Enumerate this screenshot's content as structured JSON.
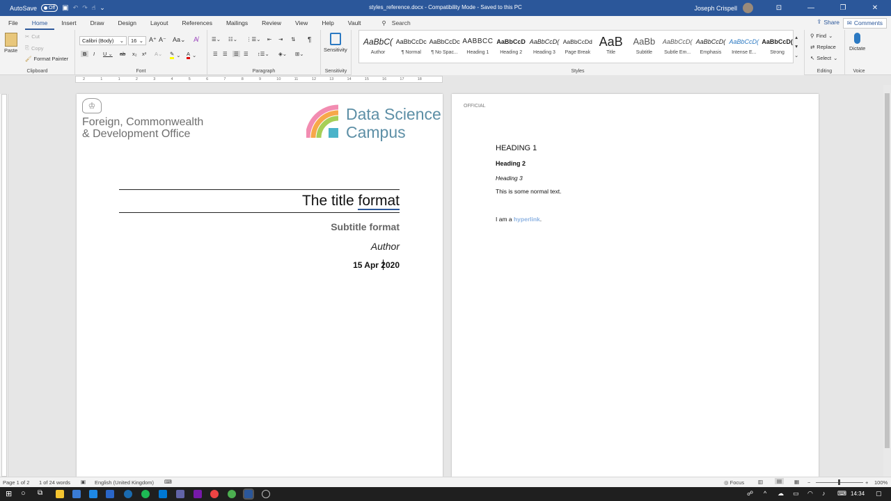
{
  "titlebar": {
    "autosave_label": "AutoSave",
    "autosave_state": "Off",
    "document_title": "styles_reference.docx  -  Compatibility Mode  -  Saved to this PC",
    "user_name": "Joseph Crispell",
    "search_placeholder": "Search"
  },
  "menu_tabs": [
    "File",
    "Home",
    "Insert",
    "Draw",
    "Design",
    "Layout",
    "References",
    "Mailings",
    "Review",
    "View",
    "Help",
    "Vault"
  ],
  "active_tab": "Home",
  "share_label": "Share",
  "comments_label": "Comments",
  "ribbon": {
    "clipboard": {
      "paste": "Paste",
      "cut": "Cut",
      "copy": "Copy",
      "format_painter": "Format Painter",
      "label": "Clipboard"
    },
    "font": {
      "font_name": "Calibri (Body)",
      "font_size": "16",
      "label": "Font"
    },
    "paragraph": {
      "label": "Paragraph"
    },
    "sensitivity": {
      "button": "Sensitivity",
      "label": "Sensitivity"
    },
    "styles": {
      "label": "Styles",
      "items": [
        {
          "preview": "AaBbC(",
          "name": "Author"
        },
        {
          "preview": "AaBbCcDc",
          "name": "¶ Normal"
        },
        {
          "preview": "AaBbCcDc",
          "name": "¶ No Spac..."
        },
        {
          "preview": "AABBCC",
          "name": "Heading 1"
        },
        {
          "preview": "AaBbCcD",
          "name": "Heading 2"
        },
        {
          "preview": "AaBbCcD(",
          "name": "Heading 3"
        },
        {
          "preview": "AaBbCcDd",
          "name": "Page Break"
        },
        {
          "preview": "AaB",
          "name": "Title"
        },
        {
          "preview": "AaBb",
          "name": "Subtitle"
        },
        {
          "preview": "AaBbCcD(",
          "name": "Subtle Em..."
        },
        {
          "preview": "AaBbCcD(",
          "name": "Emphasis"
        },
        {
          "preview": "AaBbCcD(",
          "name": "Intense E..."
        },
        {
          "preview": "AaBbCcD(",
          "name": "Strong"
        }
      ]
    },
    "editing": {
      "find": "Find",
      "replace": "Replace",
      "select": "Select",
      "label": "Editing"
    },
    "voice": {
      "dictate": "Dictate",
      "label": "Voice"
    }
  },
  "ruler_numbers": [
    "2",
    "1",
    "1",
    "2",
    "3",
    "4",
    "5",
    "6",
    "7",
    "8",
    "9",
    "10",
    "11",
    "12",
    "13",
    "14",
    "15",
    "16",
    "17",
    "18"
  ],
  "page1": {
    "fcdo_line1": "Foreign, Commonwealth",
    "fcdo_line2": "& Development Office",
    "dsc_line1": "Data Science",
    "dsc_line2": "Campus",
    "title_part1": "The title ",
    "title_part2": "format",
    "subtitle": "Subtitle format",
    "author": "Author",
    "date": "15 Apr 2020"
  },
  "page2": {
    "header": "OFFICIAL",
    "heading1": "HEADING 1",
    "heading2": "Heading 2",
    "heading3": "Heading 3",
    "normal": "This is some normal text.",
    "link_prefix": "I am a ",
    "link_text": "hyperlink",
    "link_suffix": "."
  },
  "status": {
    "page": "Page 1 of 2",
    "words": "1 of 24 words",
    "language": "English (United Kingdom)",
    "focus": "Focus",
    "zoom": "100%"
  },
  "taskbar": {
    "time": "14:34"
  },
  "colors": {
    "accent": "#2b579a",
    "hyperlink": "#8db3e2",
    "title_underline": "#2b579a"
  }
}
